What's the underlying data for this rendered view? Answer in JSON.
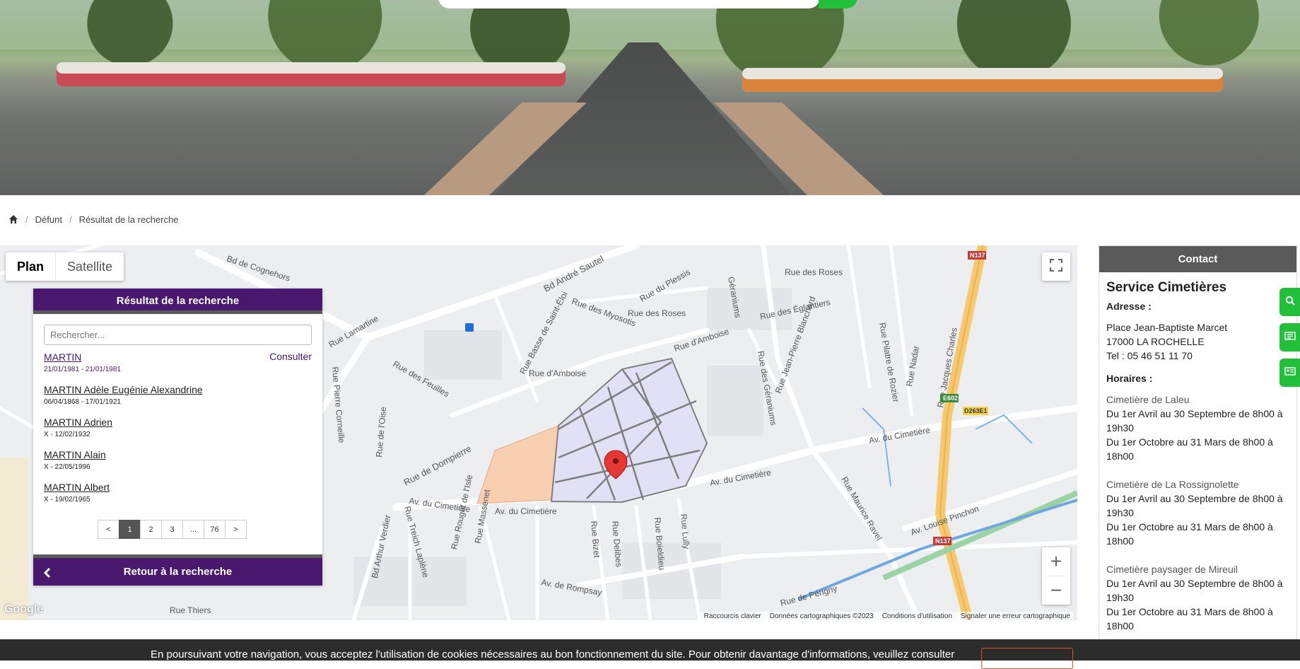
{
  "breadcrumb": {
    "items": [
      "Défunt",
      "Résultat de la recherche"
    ]
  },
  "map": {
    "tabs": {
      "plan": "Plan",
      "satellite": "Satellite"
    },
    "google": "Google",
    "attribution": [
      "Raccourcis clavier",
      "Données cartographiques ©2023",
      "Conditions d'utilisation",
      "Signaler une erreur cartographique"
    ],
    "street_labels": [
      "Bd de Cognehors",
      "Bd André Sautel",
      "Rue du Plessis",
      "Rue des Roses",
      "Rue des Myosotis",
      "Rue des Églantiers",
      "Rue d'Amboise",
      "Rue Basse de Saint-Éloi",
      "Rue des Feuilles",
      "Rue Lamartine",
      "Rue Pierre Corneille",
      "Rue de Dompierre",
      "Av. du Cimetière",
      "Rue des Géraniums",
      "Rue Jean-Pierre Blanchard",
      "Rue Pilatre de Rozier",
      "Rue Nadar",
      "Rue Jacques Charles",
      "Av. Louise Pinchon",
      "Rue Maurice Ravel",
      "Rue Lully",
      "Rue Boieldieu",
      "Rue Delibes",
      "Rue Bizet",
      "Rue Massenet",
      "Rue Rouget de l'Isle",
      "Rue Treich Laplène",
      "Bd Arthur Verdier",
      "Rue de l'Oise",
      "Av. de Rompsay",
      "Rue de Périgny",
      "Rue Thiers",
      "N137",
      "E602",
      "D263E1",
      "Géraniums"
    ],
    "fullscreen": "fullscreen-icon",
    "zoom_in": "+",
    "zoom_out": "−"
  },
  "results": {
    "header": "Résultat de la recherche",
    "search_placeholder": "Rechercher...",
    "consult_label": "Consulter",
    "items": [
      {
        "name": "MARTIN",
        "dates": "21/01/1981 - 21/01/1981"
      },
      {
        "name": "MARTIN Adèle Eugénie Alexandrine",
        "dates": "06/04/1868 - 17/01/1921"
      },
      {
        "name": "MARTIN Adrien",
        "dates": "X - 12/02/1932"
      },
      {
        "name": "MARTIN Alain",
        "dates": "X - 22/05/1996"
      },
      {
        "name": "MARTIN Albert",
        "dates": "X - 19/02/1965"
      }
    ],
    "pagination": [
      "<",
      "1",
      "2",
      "3",
      "...",
      "76",
      ">"
    ],
    "active_page": "1",
    "back_label": "Retour à la recherche"
  },
  "contact": {
    "header": "Contact",
    "title": "Service Cimetières",
    "address_label": "Adresse :",
    "address_lines": [
      "Place Jean-Baptiste Marcet",
      "17000 LA ROCHELLE",
      "Tel : 05 46 51 11 70"
    ],
    "hours_label": "Horaires :",
    "cemeteries": [
      {
        "name": "Cimetière de Laleu",
        "summer": "Du 1er Avril au 30 Septembre de 8h00 à 19h30",
        "winter": "Du 1er Octobre au 31 Mars de 8h00 à 18h00"
      },
      {
        "name": "Cimetière de La Rossignolette",
        "summer": "Du 1er Avril au 30 Septembre de 8h00 à 19h30",
        "winter": "Du 1er Octobre au 31 Mars de 8h00 à 18h00"
      },
      {
        "name": "Cimetière paysager de Mireuil",
        "summer": "Du 1er Avril au 30 Septembre de 8h00 à 19h30",
        "winter": "Du 1er Octobre au 31 Mars de 8h00 à 18h00"
      }
    ]
  },
  "cookie": {
    "text": "En poursuivant votre navigation, vous acceptez l'utilisation de cookies nécessaires au bon fonctionnement du site. Pour obtenir davantage d'informations, veuillez consulter"
  },
  "colors": {
    "accent": "#4b1870",
    "green": "#22c03a",
    "dark": "#5a5a5a",
    "cemetery_fill": "#e2e0f5",
    "cemetery_extension": "#f8cfb0"
  }
}
